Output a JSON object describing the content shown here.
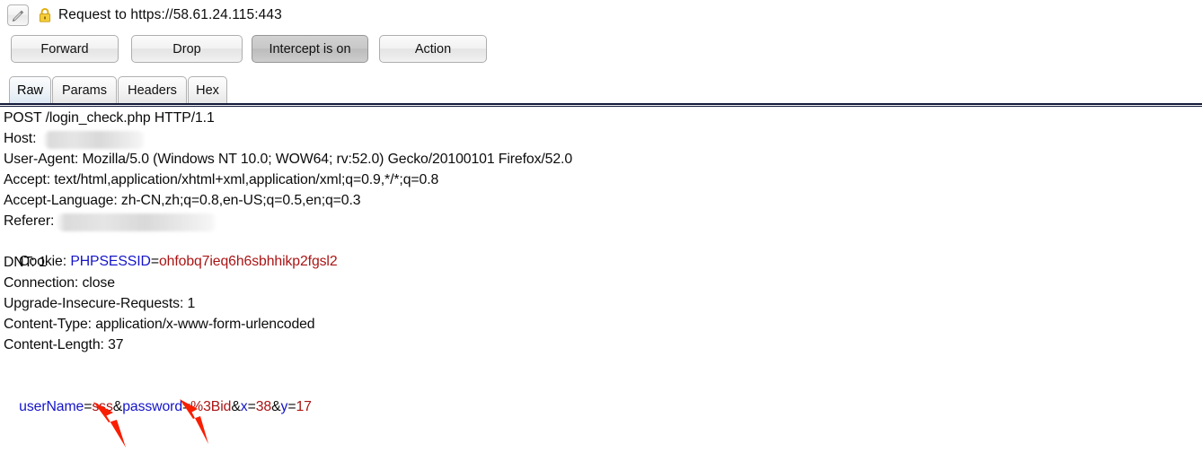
{
  "titlebar": {
    "edit_icon": "pencil-icon",
    "lock_icon": "padlock-icon",
    "title": "Request to https://58.61.24.115:443"
  },
  "toolbar": {
    "forward_label": "Forward",
    "drop_label": "Drop",
    "intercept_label": "Intercept is on",
    "action_label": "Action",
    "intercept_state": "on"
  },
  "tabs": [
    {
      "label": "Raw",
      "selected": true
    },
    {
      "label": "Params",
      "selected": false
    },
    {
      "label": "Headers",
      "selected": false
    },
    {
      "label": "Hex",
      "selected": false
    }
  ],
  "request": {
    "request_line": "POST /login_check.php HTTP/1.1",
    "host_label": "Host:",
    "user_agent": "User-Agent: Mozilla/5.0 (Windows NT 10.0; WOW64; rv:52.0) Gecko/20100101 Firefox/52.0",
    "accept": "Accept: text/html,application/xhtml+xml,application/xml;q=0.9,*/*;q=0.8",
    "accept_language": "Accept-Language: zh-CN,zh;q=0.8,en-US;q=0.5,en;q=0.3",
    "referer_label": "Referer:",
    "cookie_label": "Cookie: ",
    "cookie_name": "PHPSESSID",
    "cookie_eq": "=",
    "cookie_value": "ohfobq7ieq6h6sbhhikp2fgsl2",
    "dnt": "DNT: 1",
    "connection": "Connection: close",
    "upgrade_insecure": "Upgrade-Insecure-Requests: 1",
    "content_type": "Content-Type: application/x-www-form-urlencoded",
    "content_length": "Content-Length: 37",
    "body": {
      "param1_name": "userName",
      "sep1": "=",
      "param1_value": "sss",
      "amp1": "&",
      "param2_name": "password",
      "sep2": "=",
      "param2_value": "%3Bid",
      "amp2": "&",
      "param3_name": "x",
      "sep3": "=",
      "param3_value": "38",
      "amp3": "&",
      "param4_name": "y",
      "sep4": "=",
      "param4_value": "17"
    }
  },
  "annotations": {
    "arrow1_name": "red-arrow-pointing-to-username-value",
    "arrow2_name": "red-arrow-pointing-to-password-value",
    "arrow_color": "#f91e00"
  },
  "colors": {
    "param_name": "#1414c8",
    "param_value": "#aa1414",
    "text": "#0b0b0b",
    "separator": "#131a3a",
    "lock": "#e8b81e"
  }
}
